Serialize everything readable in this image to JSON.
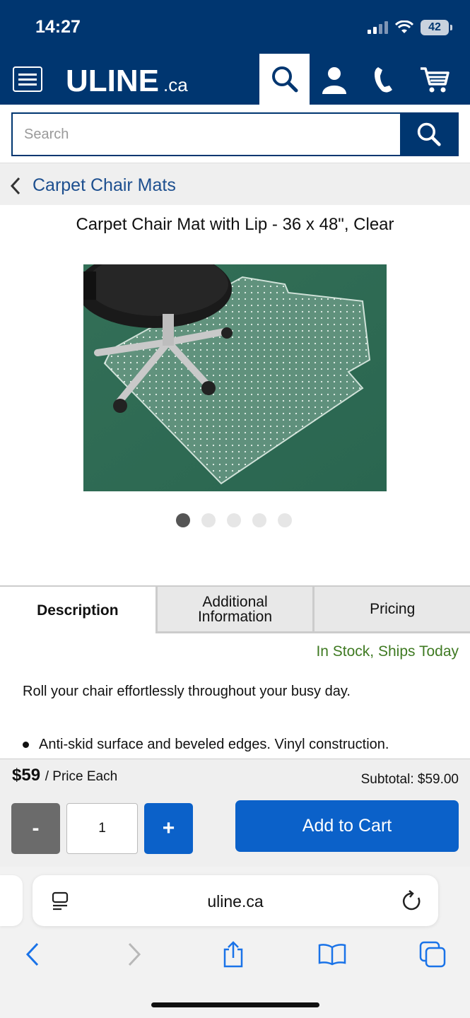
{
  "status_bar": {
    "time": "14:27",
    "battery": "42"
  },
  "header": {
    "logo": "ULINE",
    "logo_suffix": ".ca"
  },
  "search": {
    "placeholder": "Search"
  },
  "breadcrumb": {
    "label": "Carpet Chair Mats"
  },
  "product": {
    "title": "Carpet Chair Mat with Lip - 36 x 48\", Clear",
    "image_count": 5,
    "active_image": 1
  },
  "tabs": [
    {
      "line1": "Description",
      "line2": ""
    },
    {
      "line1": "Additional",
      "line2": "Information"
    },
    {
      "line1": "Pricing",
      "line2": ""
    }
  ],
  "stock_status": "In Stock, Ships Today",
  "description": "Roll your chair effortlessly throughout your busy day.",
  "bullets": [
    "Anti-skid surface and beveled edges. Vinyl construction."
  ],
  "purchase": {
    "price": "$59",
    "price_unit": "/ Price Each",
    "subtotal": "Subtotal: $59.00",
    "minus": "-",
    "quantity": "1",
    "plus": "+",
    "add_to_cart": "Add to Cart"
  },
  "browser": {
    "url": "uline.ca"
  },
  "colors": {
    "brand_navy": "#003670",
    "action_blue": "#0b61c9",
    "stock_green": "#3f7a22",
    "mat_green": "#2e6e55"
  },
  "icons": [
    "hamburger-menu-icon",
    "search-icon",
    "user-icon",
    "phone-icon",
    "cart-icon",
    "chevron-left-icon",
    "reader-icon",
    "reload-icon",
    "back-icon",
    "forward-icon",
    "share-icon",
    "bookmarks-icon",
    "tabs-icon"
  ]
}
